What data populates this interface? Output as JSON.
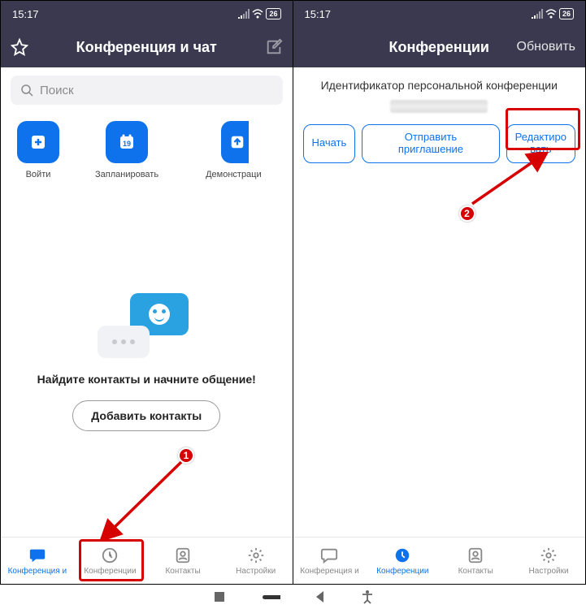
{
  "status": {
    "time": "15:17",
    "battery": "26"
  },
  "left": {
    "title": "Конференция и чат",
    "search_placeholder": "Поиск",
    "actions": {
      "join": "Войти",
      "schedule": "Запланировать",
      "share": "Демонстраци",
      "cal_day": "19"
    },
    "empty_text": "Найдите контакты и начните общение!",
    "add_contacts": "Добавить контакты",
    "nav": {
      "chat": "Конференция и",
      "meet": "Конференции",
      "contacts": "Контакты",
      "settings": "Настройки"
    }
  },
  "right": {
    "title": "Конференции",
    "refresh": "Обновить",
    "pmi_label": "Идентификатор персональной конференции",
    "buttons": {
      "start": "Начать",
      "invite": "Отправить приглашение",
      "edit": "Редактиро\nвать"
    },
    "nav": {
      "chat": "Конференция и",
      "meet": "Конференции",
      "contacts": "Контакты",
      "settings": "Настройки"
    }
  },
  "markers": {
    "one": "1",
    "two": "2"
  }
}
